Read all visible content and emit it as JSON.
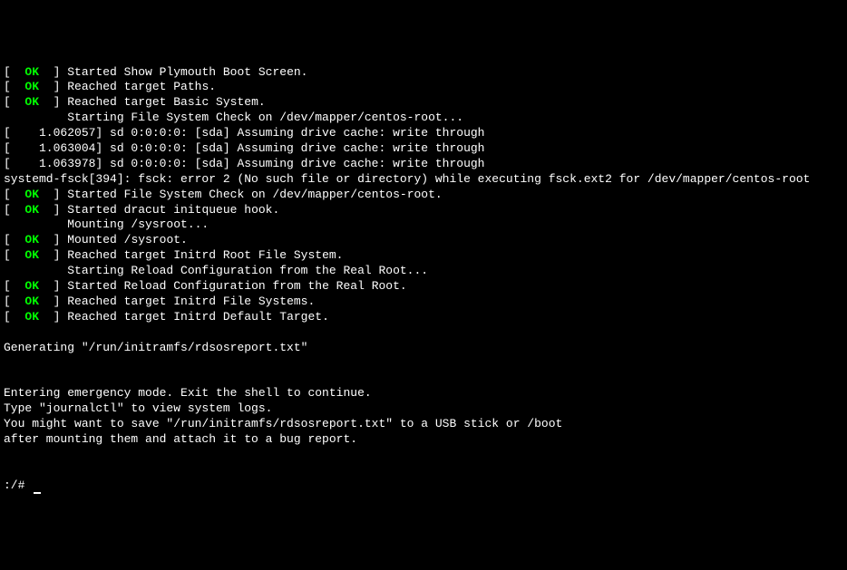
{
  "lines": [
    {
      "type": "ok",
      "msg": "Started Show Plymouth Boot Screen."
    },
    {
      "type": "ok",
      "msg": "Reached target Paths."
    },
    {
      "type": "ok",
      "msg": "Reached target Basic System."
    },
    {
      "type": "indent",
      "msg": "Starting File System Check on /dev/mapper/centos-root..."
    },
    {
      "type": "ts",
      "ts": "1.062057",
      "msg": "sd 0:0:0:0: [sda] Assuming drive cache: write through"
    },
    {
      "type": "ts",
      "ts": "1.063004",
      "msg": "sd 0:0:0:0: [sda] Assuming drive cache: write through"
    },
    {
      "type": "ts",
      "ts": "1.063978",
      "msg": "sd 0:0:0:0: [sda] Assuming drive cache: write through"
    },
    {
      "type": "plain",
      "msg": "systemd-fsck[394]: fsck: error 2 (No such file or directory) while executing fsck.ext2 for /dev/mapper/centos-root"
    },
    {
      "type": "ok",
      "msg": "Started File System Check on /dev/mapper/centos-root."
    },
    {
      "type": "ok",
      "msg": "Started dracut initqueue hook."
    },
    {
      "type": "indent",
      "msg": "Mounting /sysroot..."
    },
    {
      "type": "ok",
      "msg": "Mounted /sysroot."
    },
    {
      "type": "ok",
      "msg": "Reached target Initrd Root File System."
    },
    {
      "type": "indent",
      "msg": "Starting Reload Configuration from the Real Root..."
    },
    {
      "type": "ok",
      "msg": "Started Reload Configuration from the Real Root."
    },
    {
      "type": "ok",
      "msg": "Reached target Initrd File Systems."
    },
    {
      "type": "ok",
      "msg": "Reached target Initrd Default Target."
    },
    {
      "type": "plain",
      "msg": ""
    },
    {
      "type": "plain",
      "msg": "Generating \"/run/initramfs/rdsosreport.txt\""
    },
    {
      "type": "plain",
      "msg": ""
    },
    {
      "type": "plain",
      "msg": ""
    },
    {
      "type": "plain",
      "msg": "Entering emergency mode. Exit the shell to continue."
    },
    {
      "type": "plain",
      "msg": "Type \"journalctl\" to view system logs."
    },
    {
      "type": "plain",
      "msg": "You might want to save \"/run/initramfs/rdsosreport.txt\" to a USB stick or /boot"
    },
    {
      "type": "plain",
      "msg": "after mounting them and attach it to a bug report."
    },
    {
      "type": "plain",
      "msg": ""
    },
    {
      "type": "plain",
      "msg": ""
    }
  ],
  "ok_label": "OK",
  "prompt": ":/# "
}
